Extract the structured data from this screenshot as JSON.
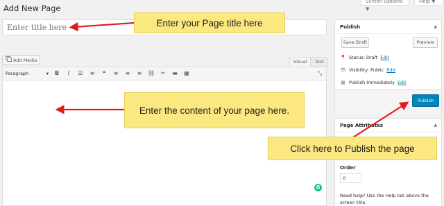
{
  "top_buttons": {
    "screen_options": "Screen Options ▼",
    "help": "Help ▼"
  },
  "page": {
    "heading": "Add New Page",
    "title_placeholder": "Enter title here"
  },
  "editor": {
    "add_media": "Add Media",
    "tab_visual": "Visual",
    "tab_text": "Text",
    "format_select": "Paragraph",
    "toolbar_icons": [
      "bold-icon",
      "italic-icon",
      "bullet-list-icon",
      "numbered-list-icon",
      "blockquote-icon",
      "align-left-icon",
      "align-center-icon",
      "align-right-icon",
      "link-icon",
      "unlink-icon",
      "read-more-icon",
      "toolbar-toggle-icon",
      "fullscreen-icon"
    ],
    "grammarly": "G"
  },
  "publish_box": {
    "title": "Publish",
    "save_draft": "Save Draft",
    "preview": "Preview",
    "status_label": "Status: Draft",
    "visibility_label": "Visibility: Public",
    "publish_date_label": "Publish Immediately",
    "edit_link": "Edit",
    "publish_button": "Publish"
  },
  "attributes_box": {
    "title": "Page Attributes",
    "order_label": "Order",
    "order_value": "0",
    "help_text": "Need help? Use the Help tab above the screen title."
  },
  "callouts": {
    "title": "Enter your Page title here",
    "content": "Enter the content of your page here.",
    "publish": "Click here to Publish the page"
  },
  "colors": {
    "callout_bg": "#fce880",
    "arrow": "#e01e1e",
    "publish_button": "#0085ba",
    "link": "#0073aa"
  }
}
